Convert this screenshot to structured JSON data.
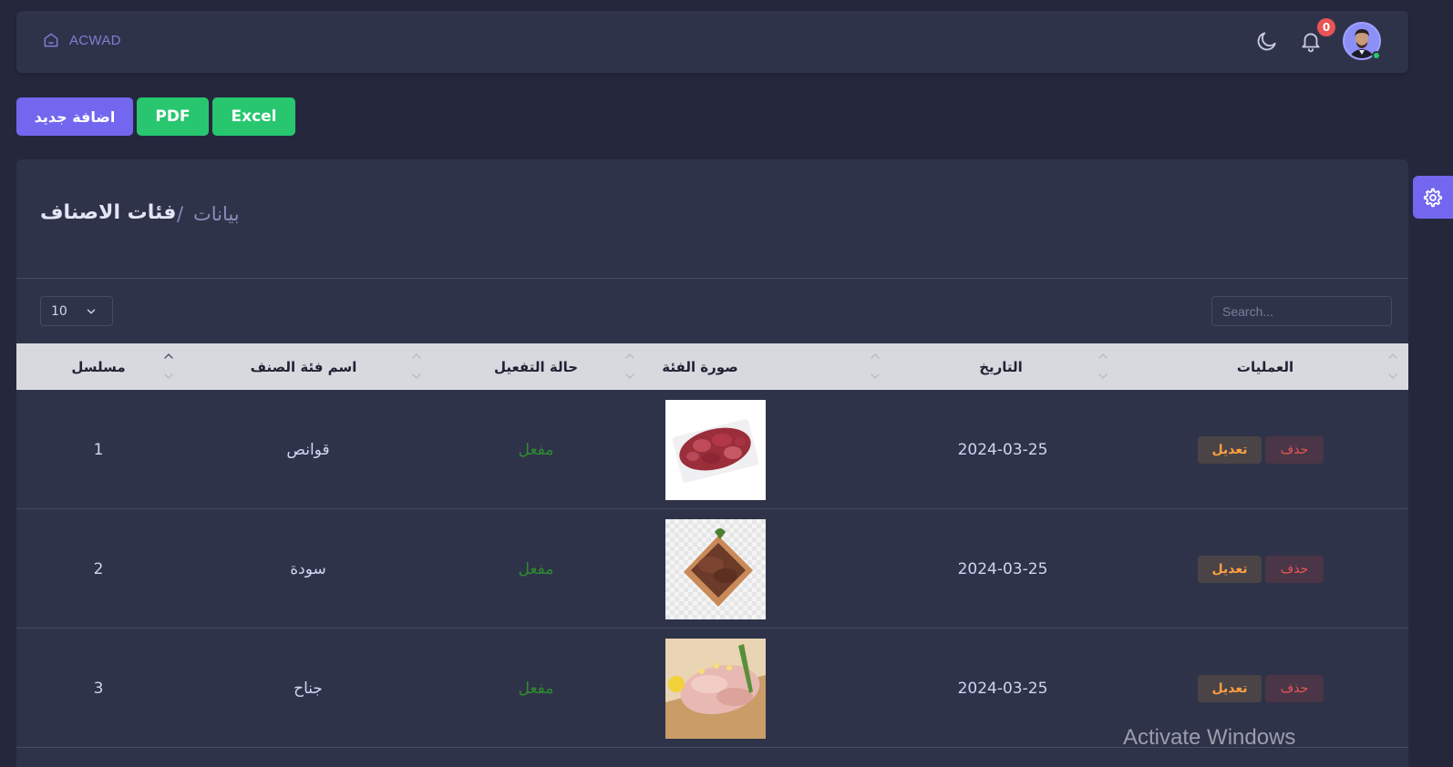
{
  "navbar": {
    "brand": "ACWAD",
    "notifications_count": "0",
    "icons": [
      "home-icon",
      "moon-icon",
      "bell-icon"
    ]
  },
  "actions": {
    "add_new": "اضافة جديد",
    "pdf": "PDF",
    "excel": "Excel"
  },
  "breadcrumb": {
    "current": "فئات الاصناف",
    "separator": "/",
    "parent": "بيانات"
  },
  "table_controls": {
    "page_size": "10",
    "search_placeholder": "Search..."
  },
  "table": {
    "columns": {
      "serial": "مسلسل",
      "name": "اسم فئة الصنف",
      "status": "حالة التفعيل",
      "image": "صورة الفئة",
      "date": "التاريخ",
      "ops": "العمليات"
    },
    "rows": [
      {
        "serial": "1",
        "name": "قوانص",
        "status": "مفعل",
        "date": "2024-03-25",
        "edit": "تعديل",
        "delete": "حذف"
      },
      {
        "serial": "2",
        "name": "سودة",
        "status": "مفعل",
        "date": "2024-03-25",
        "edit": "تعديل",
        "delete": "حذف"
      },
      {
        "serial": "3",
        "name": "جناح",
        "status": "مفعل",
        "date": "2024-03-25",
        "edit": "تعديل",
        "delete": "حذف"
      }
    ]
  },
  "watermark": "Activate Windows",
  "colors": {
    "background": "#25283d",
    "card": "#2f3349",
    "primary": "#7367f0",
    "success": "#28c76f",
    "danger": "#ea5455",
    "warning": "#ff9f43"
  }
}
